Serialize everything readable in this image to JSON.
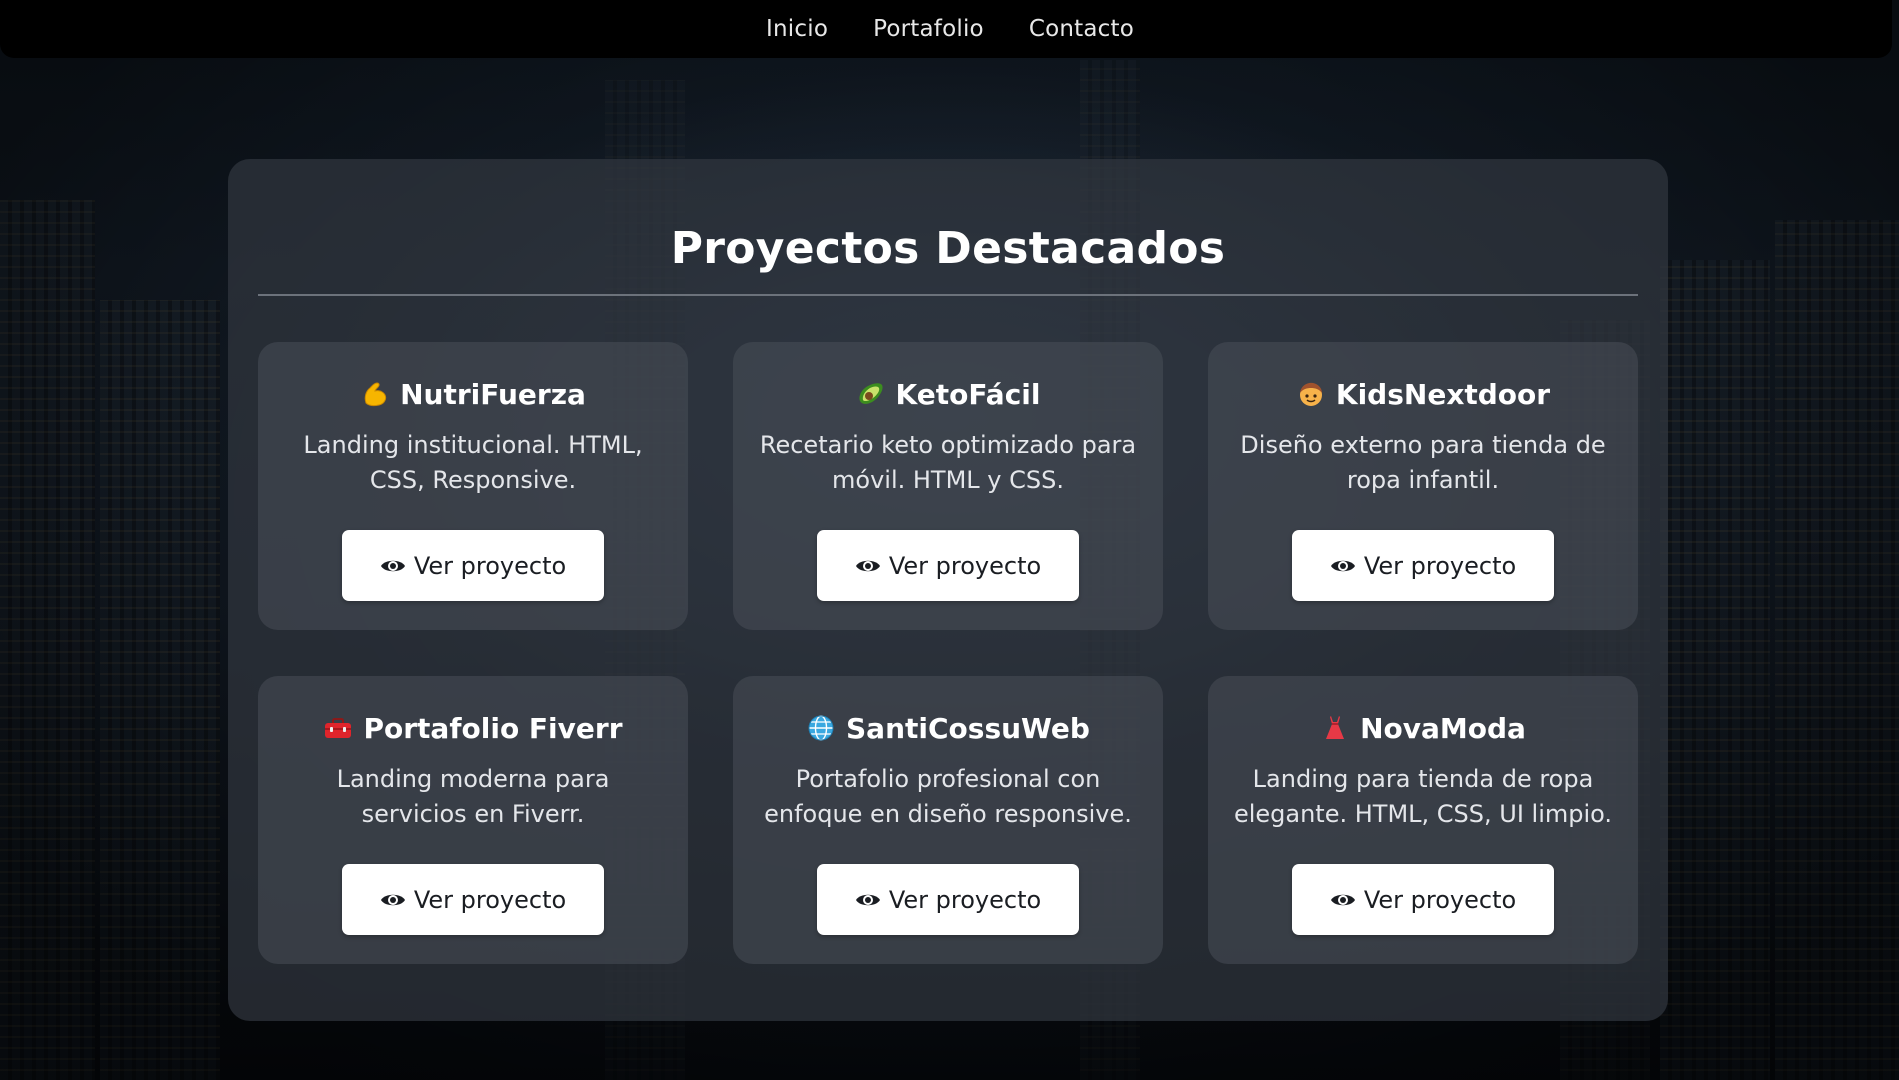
{
  "nav": {
    "items": [
      {
        "label": "Inicio"
      },
      {
        "label": "Portafolio"
      },
      {
        "label": "Contacto"
      }
    ]
  },
  "section": {
    "title": "Proyectos Destacados"
  },
  "projects": [
    {
      "icon": "flexed-biceps-icon",
      "title": "NutriFuerza",
      "description": "Landing institucional. HTML, CSS, Responsive.",
      "button_label": "Ver proyecto"
    },
    {
      "icon": "avocado-icon",
      "title": "KetoFácil",
      "description": "Recetario keto optimizado para móvil. HTML y CSS.",
      "button_label": "Ver proyecto"
    },
    {
      "icon": "child-face-icon",
      "title": "KidsNextdoor",
      "description": "Diseño externo para tienda de ropa infantil.",
      "button_label": "Ver proyecto"
    },
    {
      "icon": "toolbox-icon",
      "title": "Portafolio Fiverr",
      "description": "Landing moderna para servicios en Fiverr.",
      "button_label": "Ver proyecto"
    },
    {
      "icon": "globe-icon",
      "title": "SantiCossuWeb",
      "description": "Portafolio profesional con enfoque en diseño responsive.",
      "button_label": "Ver proyecto"
    },
    {
      "icon": "dress-icon",
      "title": "NovaModa",
      "description": "Landing para tienda de ropa elegante. HTML, CSS, UI limpio.",
      "button_label": "Ver proyecto"
    }
  ],
  "colors": {
    "navbar": "#000000",
    "panel": "#30363f",
    "button_bg": "#ffffff",
    "button_text": "#1a1d22"
  }
}
